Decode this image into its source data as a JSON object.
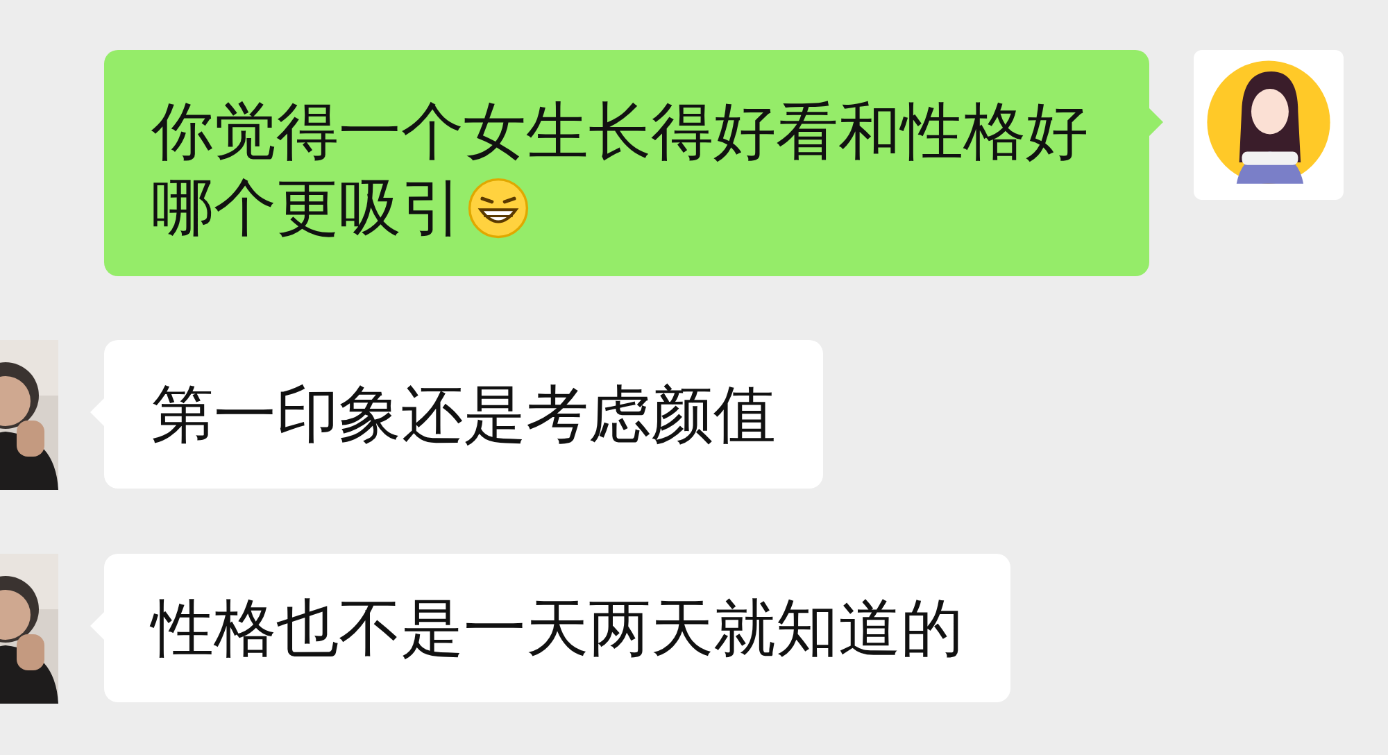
{
  "messages": [
    {
      "kind": "outgoing",
      "text": "你觉得一个女生长得好看和性格好哪个更吸引",
      "trailing_emoji": true
    },
    {
      "kind": "incoming",
      "text": "第一印象还是考虑颜值",
      "trailing_emoji": false
    },
    {
      "kind": "incoming",
      "text": "性格也不是一天两天就知道的",
      "trailing_emoji": false
    }
  ]
}
